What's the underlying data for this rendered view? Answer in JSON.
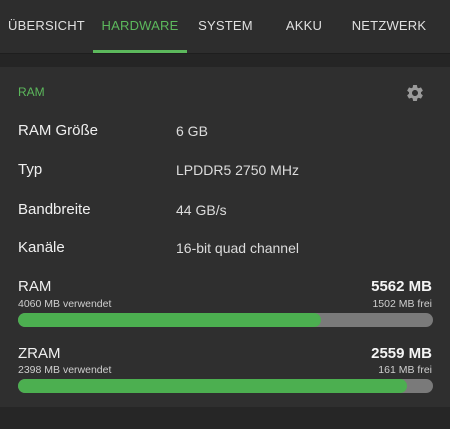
{
  "tabs": [
    {
      "label": "ÜBERSICHT",
      "active": false
    },
    {
      "label": "HARDWARE",
      "active": true
    },
    {
      "label": "SYSTEM",
      "active": false
    },
    {
      "label": "AKKU",
      "active": false
    },
    {
      "label": "NETZWERK",
      "active": false
    }
  ],
  "colors": {
    "accent": "#5cb85c",
    "bar_fill": "#4caf50",
    "bar_track": "#7a7a7a",
    "background": "#252525",
    "card": "#2f2f2f"
  },
  "section": {
    "title": "RAM",
    "settings_icon": "gear-icon"
  },
  "specs": [
    {
      "label": "RAM Größe",
      "value": "6 GB"
    },
    {
      "label": "Typ",
      "value": "LPDDR5 2750 MHz"
    },
    {
      "label": "Bandbreite",
      "value": "44 GB/s"
    },
    {
      "label": "Kanäle",
      "value": "16-bit quad channel"
    }
  ],
  "memory": {
    "ram": {
      "title": "RAM",
      "total": "5562 MB",
      "used": "4060 MB verwendet",
      "free": "1502 MB frei",
      "used_fraction": 0.73
    },
    "zram": {
      "title": "ZRAM",
      "total": "2559 MB",
      "used": "2398 MB verwendet",
      "free": "161 MB frei",
      "used_fraction": 0.937
    }
  }
}
